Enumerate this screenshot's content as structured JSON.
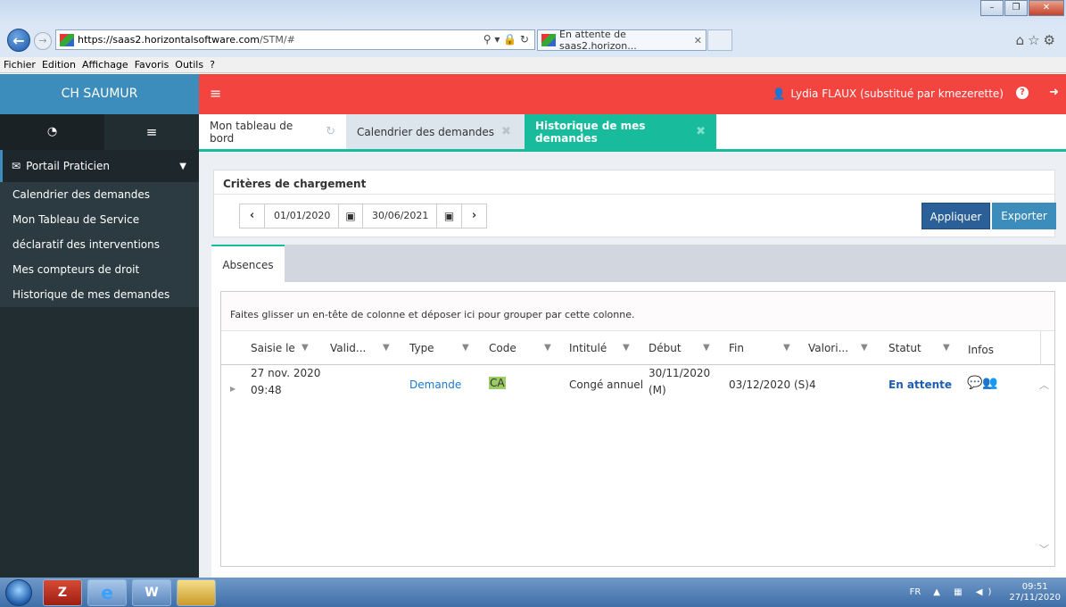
{
  "browser": {
    "url_host": "https://saas2.horizontalsoftware.com",
    "url_path": "/STM/#",
    "tab_title": "En attente de saas2.horizon...",
    "menu": [
      "Fichier",
      "Edition",
      "Affichage",
      "Favoris",
      "Outils",
      "?"
    ]
  },
  "app": {
    "brand": "CH SAUMUR",
    "user": "Lydia FLAUX (substitué par kmezerette)"
  },
  "sidebar": {
    "portal_label": "Portail Praticien",
    "items": [
      {
        "label": "Calendrier des demandes"
      },
      {
        "label": "Mon Tableau de Service"
      },
      {
        "label": "déclaratif des interventions"
      },
      {
        "label": "Mes compteurs de droit"
      },
      {
        "label": "Historique de mes demandes"
      }
    ]
  },
  "tabs": [
    {
      "label": "Mon tableau de bord",
      "icon": "refresh-icon"
    },
    {
      "label": "Calendrier des demandes",
      "icon": "close-icon"
    },
    {
      "label": "Historique de mes demandes",
      "icon": "close-icon",
      "active": true
    }
  ],
  "criteria": {
    "title": "Critères de chargement",
    "date_from": "01/01/2020",
    "date_to": "30/06/2021",
    "apply_label": "Appliquer",
    "export_label": "Exporter"
  },
  "subtab": {
    "label": "Absences"
  },
  "grid": {
    "group_hint": "Faites glisser un en-tête de colonne et déposer ici pour grouper par cette colonne.",
    "columns": [
      "Saisie le",
      "Valid...",
      "Type",
      "Code",
      "Intitulé",
      "Début",
      "Fin",
      "Valori...",
      "Statut",
      "Infos"
    ],
    "rows": [
      {
        "saisie_date": "27 nov. 2020",
        "saisie_time": "09:48",
        "valid": "",
        "type": "Demande",
        "code": "CA",
        "intitule": "Congé annuel",
        "debut_date": "30/11/2020",
        "debut_period": "(M)",
        "fin": "03/12/2020 (S)",
        "valori": "4",
        "statut": "En attente",
        "infos_icon": "comments-users-icon"
      }
    ]
  },
  "taskbar": {
    "lang": "FR",
    "time": "09:51",
    "date": "27/11/2020"
  },
  "colors": {
    "brand_blue": "#3c8dbc",
    "topbar_red": "#f4443f",
    "sidebar_dark": "#222d32",
    "accent_green": "#18bc9c",
    "apply_blue": "#2a5f97"
  }
}
